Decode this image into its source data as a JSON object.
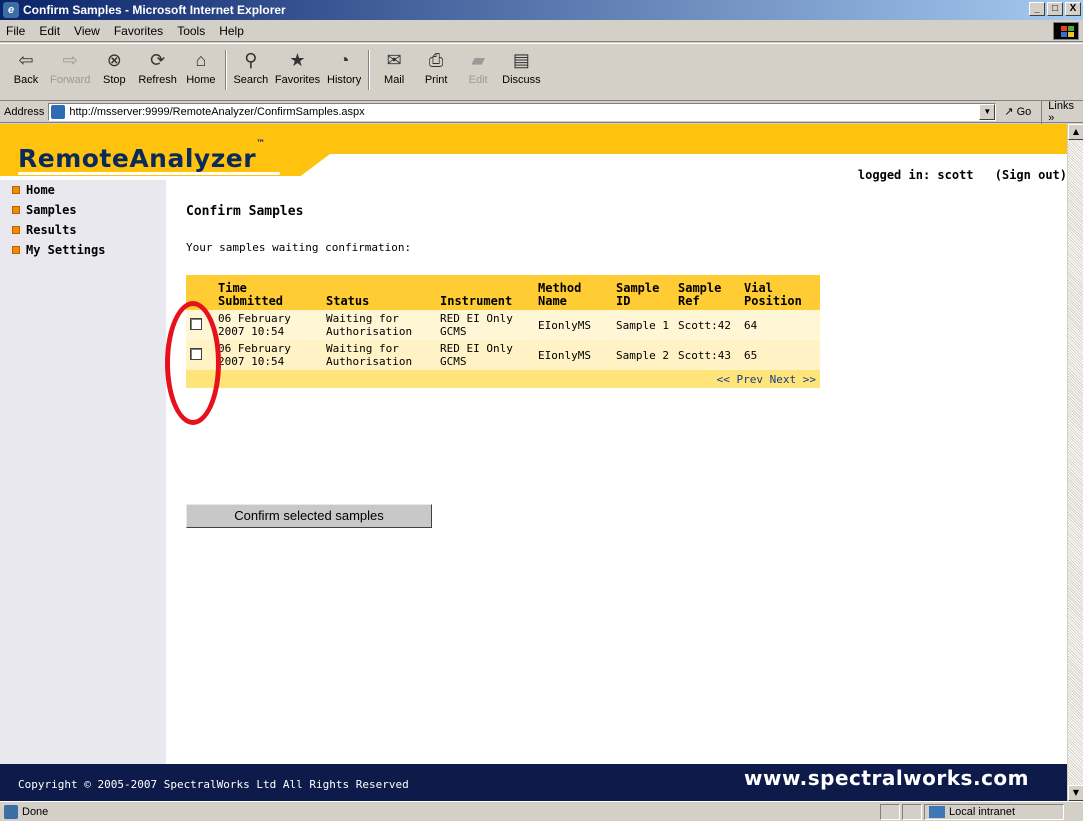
{
  "window": {
    "title": "Confirm Samples - Microsoft Internet Explorer",
    "controls": [
      "_",
      "□",
      "X"
    ]
  },
  "menu": [
    "File",
    "Edit",
    "View",
    "Favorites",
    "Tools",
    "Help"
  ],
  "toolbar": {
    "back": "Back",
    "forward": "Forward",
    "stop": "Stop",
    "refresh": "Refresh",
    "home": "Home",
    "search": "Search",
    "favorites": "Favorites",
    "history": "History",
    "mail": "Mail",
    "print": "Print",
    "edit": "Edit",
    "discuss": "Discuss"
  },
  "address": {
    "label": "Address",
    "url": "http://msserver:9999/RemoteAnalyzer/ConfirmSamples.aspx",
    "go": "Go",
    "links": "Links »"
  },
  "site": {
    "logo": "RemoteAnalyzer",
    "logo_tm": "™",
    "logged_in": "logged in: scott",
    "sign_out": "(Sign out)"
  },
  "nav": [
    "Home",
    "Samples",
    "Results",
    "My Settings"
  ],
  "page": {
    "title": "Confirm Samples",
    "subtitle": "Your samples waiting confirmation:",
    "columns": {
      "time": "Time Submitted",
      "status": "Status",
      "instrument": "Instrument",
      "method": "Method Name",
      "sample_id": "Sample ID",
      "sample_ref": "Sample Ref",
      "vial": "Vial Position"
    },
    "rows": [
      {
        "time": "06 February 2007 10:54",
        "status": "Waiting for Authorisation",
        "instrument": "RED EI Only GCMS",
        "method": "EIonlyMS",
        "sample_id": "Sample 1",
        "sample_ref": "Scott:42",
        "vial": "64"
      },
      {
        "time": "06 February 2007 10:54",
        "status": "Waiting for Authorisation",
        "instrument": "RED EI Only GCMS",
        "method": "EIonlyMS",
        "sample_id": "Sample 2",
        "sample_ref": "Scott:43",
        "vial": "65"
      }
    ],
    "pager": "<< Prev Next >>",
    "confirm_button": "Confirm selected samples"
  },
  "footer": {
    "copyright": "Copyright © 2005-2007 SpectralWorks Ltd  All Rights Reserved",
    "website": "www.spectralworks.com"
  },
  "status": {
    "text": "Done",
    "zone": "Local intranet"
  },
  "colors": {
    "header_yellow": "#ffc20e",
    "footer_navy": "#0e1b4a",
    "annotation_red": "#e8101c"
  }
}
